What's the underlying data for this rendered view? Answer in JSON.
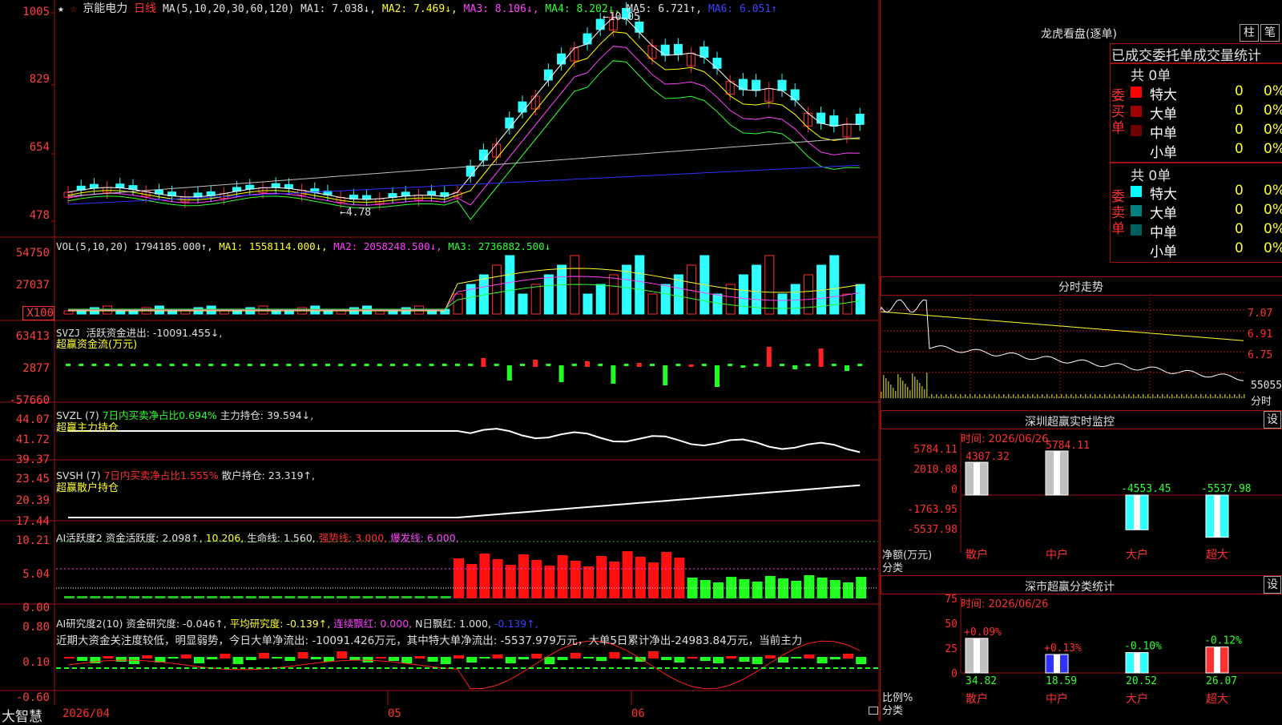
{
  "header": {
    "star": "★",
    "star2": "☆",
    "stock_name": "京能电力",
    "period": "日线",
    "ma_params": "MA(5,10,20,30,60,120)",
    "ma1": "MA1: 7.038↓,",
    "ma2": "MA2: 7.469↓,",
    "ma3": "MA3: 8.106↓,",
    "ma4": "MA4: 8.202↓,",
    "ma5": "MA5: 6.721↑,",
    "ma6": "MA6: 6.051↑",
    "high_label": "10.05",
    "low_label": "4.78"
  },
  "price_axis": [
    "1005",
    "829",
    "654",
    "478"
  ],
  "vol": {
    "title": "VOL(5,10,20)",
    "value": "1794185.000↑,",
    "ma1": "MA1: 1558114.000↓,",
    "ma2": "MA2: 2058248.500↓,",
    "ma3": "MA3: 2736882.500↓",
    "axis": [
      "54750",
      "27037",
      "X100"
    ]
  },
  "svzj": {
    "title": "SVZJ",
    "text": "活跃资金进出: -10091.455↓,",
    "sub": "超赢资金流(万元)",
    "axis": [
      "63413",
      "2877",
      "-57660"
    ]
  },
  "svzl": {
    "title": "SVZL (7)",
    "text1": "7日内买卖净占比0.694%",
    "text2": "主力持仓: 39.594↓,",
    "sub": "超赢主力持仓",
    "axis": [
      "44.07",
      "41.72",
      "39.37"
    ]
  },
  "svsh": {
    "title": "SVSH (7)",
    "text1": "7日内买卖净占比1.555%",
    "text2": "散户持仓: 23.319↑,",
    "sub": "超赢散户持仓",
    "axis": [
      "23.45",
      "20.39",
      "17.44"
    ]
  },
  "ai_active": {
    "title": "AI活跃度2",
    "t1": "资金活跃度: 2.098↑,",
    "t2": "10.206,",
    "t3": "生命线: 1.560,",
    "t4": "强势线: 3.000,",
    "t5": "爆发线: 6.000,",
    "axis": [
      "10.21",
      "5.04",
      "0.00"
    ]
  },
  "ai_research": {
    "title": "AI研究度2(10)",
    "t1": "资金研究度: -0.046↑,",
    "t2": "平均研究度: -0.139↑,",
    "t3": "连续飘红: 0.000,",
    "t4": "N日飘红: 1.000,",
    "t5": "-0.139↑,",
    "comment": "近期大资金关注度较低，明显弱势，今日大单净流出: -10091.426万元，其中特大单净流出: -5537.979万元，大单5日累计净出-24983.84万元，当前主力",
    "axis": [
      "0.80",
      "0.10",
      "-0.60"
    ]
  },
  "date_axis": {
    "brand": "大智慧",
    "d1": "2026/04",
    "d2": "05",
    "d3": "06"
  },
  "lhb": {
    "title": "龙虎看盘(逐单)",
    "btn1": "柱",
    "btn2": "笔",
    "header": "已成交委托单成交量统计",
    "buy_label": "委买单",
    "sell_label": "委卖单",
    "buy_total": "共 0单",
    "sell_total": "共 0单",
    "buy_rows": [
      {
        "name": "特大",
        "count": "0",
        "pct": "0%",
        "color": "#ff0000"
      },
      {
        "name": "大单",
        "count": "0",
        "pct": "0%",
        "color": "#a00000"
      },
      {
        "name": "中单",
        "count": "0",
        "pct": "0%",
        "color": "#700000"
      },
      {
        "name": "小单",
        "count": "0",
        "pct": "0%",
        "color": "#000000"
      }
    ],
    "sell_rows": [
      {
        "name": "特大",
        "count": "0",
        "pct": "0%",
        "color": "#00ffff"
      },
      {
        "name": "大单",
        "count": "0",
        "pct": "0%",
        "color": "#008080"
      },
      {
        "name": "中单",
        "count": "0",
        "pct": "0%",
        "color": "#006060"
      },
      {
        "name": "小单",
        "count": "0",
        "pct": "0%",
        "color": "#000000"
      }
    ]
  },
  "intraday": {
    "title": "分时走势",
    "axis": [
      "7.07",
      "6.91",
      "6.75"
    ],
    "vol_label": "55055",
    "vol_unit": "分时"
  },
  "sz_monitor": {
    "title": "深圳超赢实时监控",
    "btn": "设",
    "time": "时间: 2026/06/26",
    "axis": [
      "5784.11",
      "2010.08",
      "0",
      "-1763.95",
      "-5537.98"
    ],
    "ylabel1": "净额(万元)",
    "ylabel2": "分类",
    "bars": [
      {
        "cat": "散户",
        "value": "4307.32"
      },
      {
        "cat": "中户",
        "value": "5784.11"
      },
      {
        "cat": "大户",
        "value": "-4553.45"
      },
      {
        "cat": "超大",
        "value": "-5537.98"
      }
    ]
  },
  "sz_stats": {
    "title": "深市超赢分类统计",
    "btn": "设",
    "time": "时间: 2026/06/26",
    "axis": [
      "75",
      "50",
      "25",
      "0"
    ],
    "ylabel1": "比例%",
    "ylabel2": "分类",
    "bars": [
      {
        "cat": "散户",
        "delta": "+0.09%",
        "value": "34.82"
      },
      {
        "cat": "中户",
        "delta": "+0.13%",
        "value": "18.59"
      },
      {
        "cat": "大户",
        "delta": "-0.10%",
        "value": "20.52"
      },
      {
        "cat": "超大",
        "delta": "-0.12%",
        "value": "26.07"
      }
    ]
  },
  "colors": {
    "up": "#ff3030",
    "down": "#30ffff",
    "grid": "#a01010",
    "ma1": "#ffffff",
    "ma2": "#ffff00",
    "ma3": "#ff40ff",
    "ma4": "#30ff30",
    "ma5": "#c0c0c0",
    "ma6": "#3030ff"
  }
}
